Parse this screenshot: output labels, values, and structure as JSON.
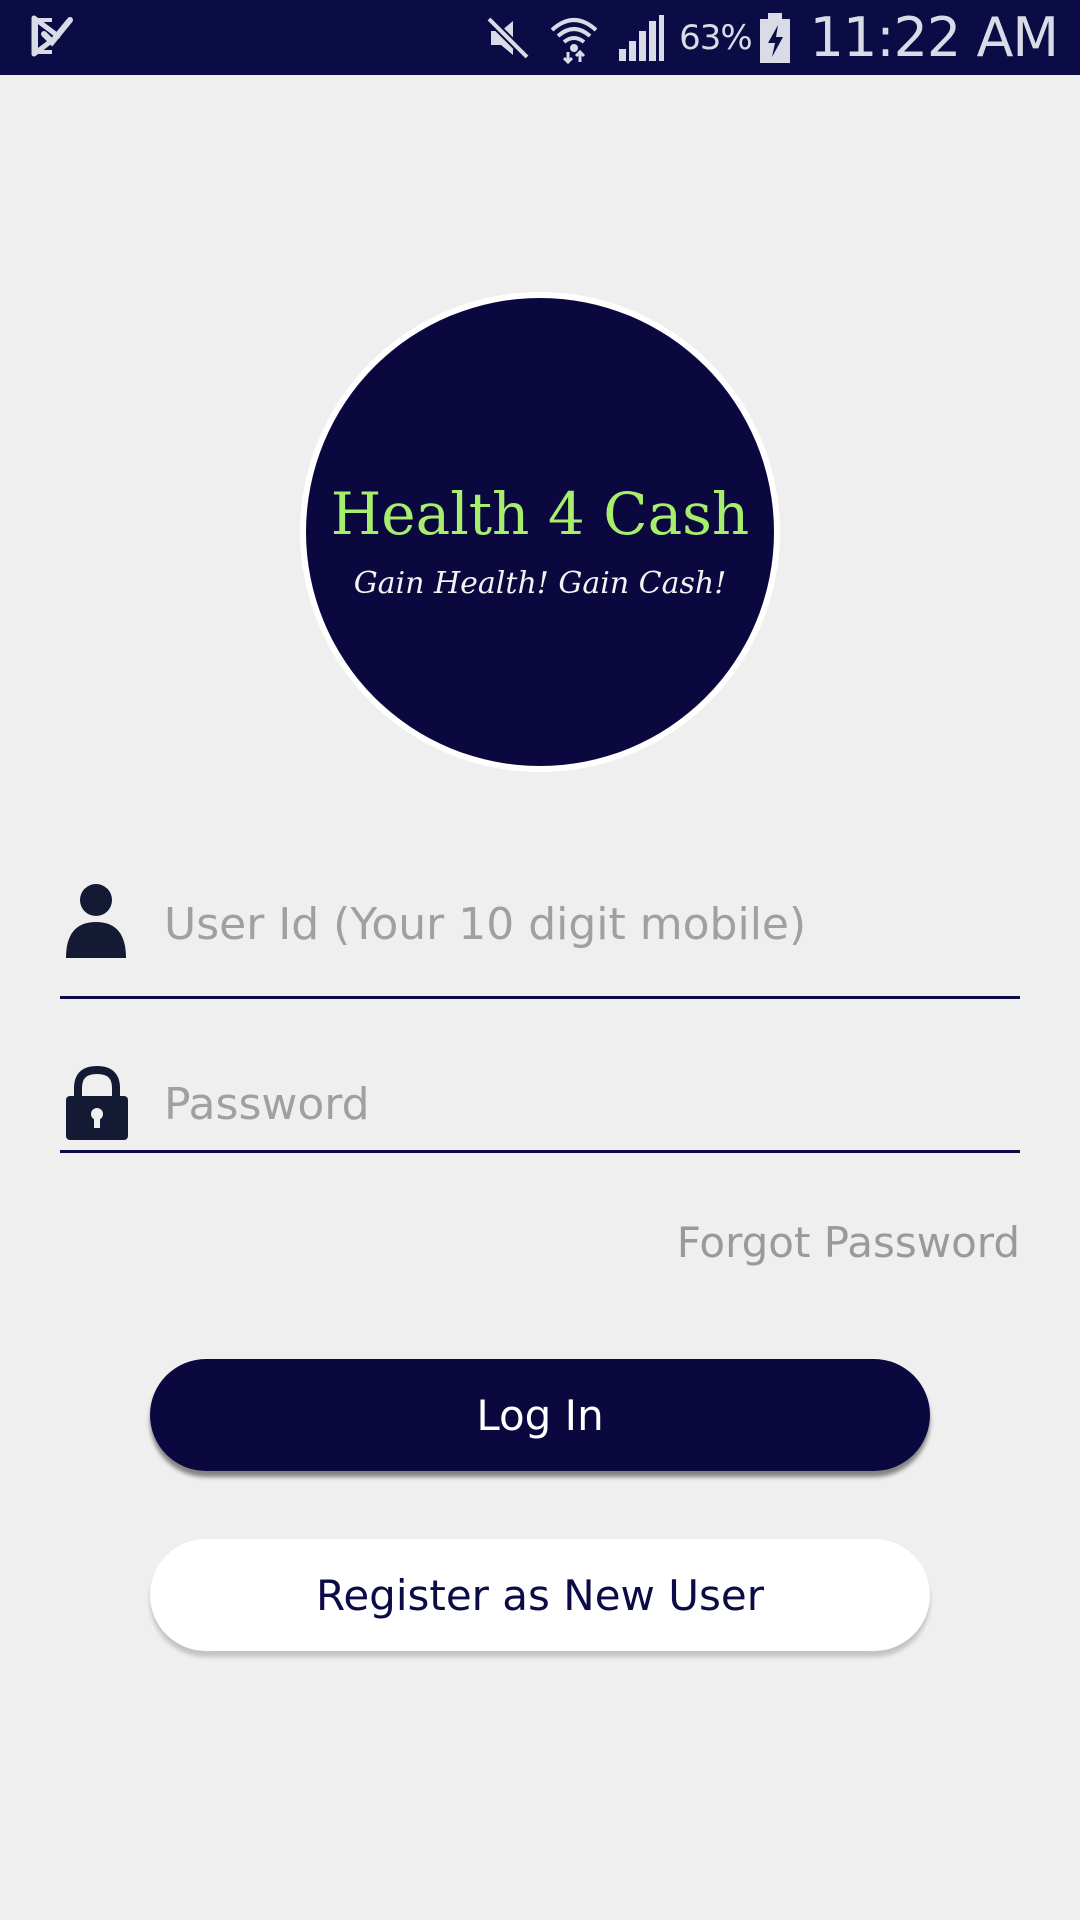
{
  "status_bar": {
    "left_icon": "notification-check-icon",
    "icons": [
      "mute-icon",
      "wifi-icon",
      "signal-icon"
    ],
    "battery_percent": "63%",
    "battery_icon": "battery-charging-icon",
    "time": "11:22 AM",
    "background_color": "#0b0b45"
  },
  "logo": {
    "title": "Health 4 Cash",
    "subtitle": "Gain Health! Gain Cash!",
    "title_color": "#a6ee6c",
    "background_color": "#0b0840"
  },
  "form": {
    "user_id": {
      "icon": "person-icon",
      "placeholder": "User Id (Your 10 digit mobile)",
      "value": ""
    },
    "password": {
      "icon": "lock-icon",
      "placeholder": "Password",
      "value": ""
    },
    "forgot_password_label": "Forgot Password",
    "login_label": "Log In",
    "register_label": "Register as New User"
  },
  "colors": {
    "primary": "#0b0840",
    "background": "#efefef",
    "hint_text": "#a0a0a0"
  }
}
